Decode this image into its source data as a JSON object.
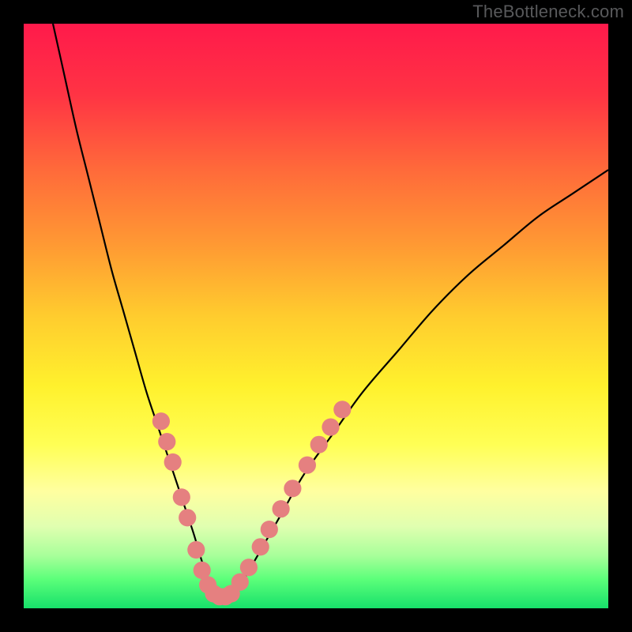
{
  "watermark": "TheBottleneck.com",
  "gradient": {
    "stops": [
      {
        "offset": 0,
        "color": "#ff1a4b"
      },
      {
        "offset": 12,
        "color": "#ff3344"
      },
      {
        "offset": 25,
        "color": "#ff6a3a"
      },
      {
        "offset": 38,
        "color": "#ff9a33"
      },
      {
        "offset": 50,
        "color": "#ffcc2e"
      },
      {
        "offset": 62,
        "color": "#fff12d"
      },
      {
        "offset": 72,
        "color": "#ffff55"
      },
      {
        "offset": 80,
        "color": "#ffffa0"
      },
      {
        "offset": 86,
        "color": "#e0ffb0"
      },
      {
        "offset": 91,
        "color": "#a8ff9a"
      },
      {
        "offset": 95,
        "color": "#5cff7a"
      },
      {
        "offset": 100,
        "color": "#17e06a"
      }
    ]
  },
  "chart_data": {
    "type": "line",
    "title": "",
    "xlabel": "",
    "ylabel": "",
    "xlim": [
      0,
      100
    ],
    "ylim": [
      0,
      100
    ],
    "grid": false,
    "legend": false,
    "series": [
      {
        "name": "curve",
        "x": [
          5,
          7,
          9,
          11,
          13,
          15,
          17,
          19,
          21,
          23,
          25,
          27,
          29,
          30.5,
          32,
          33.5,
          35,
          37,
          40,
          44,
          48,
          53,
          58,
          64,
          70,
          76,
          82,
          88,
          94,
          100
        ],
        "y": [
          100,
          91,
          82,
          74,
          66,
          58,
          51,
          44,
          37,
          31,
          25,
          19,
          13,
          8,
          4,
          2,
          2,
          4,
          9,
          16,
          23,
          30,
          37,
          44,
          51,
          57,
          62,
          67,
          71,
          75
        ]
      }
    ],
    "markers": {
      "name": "highlight-dots",
      "color": "#e58080",
      "radius": 1.5,
      "points": [
        {
          "x": 23.5,
          "y": 32
        },
        {
          "x": 24.5,
          "y": 28.5
        },
        {
          "x": 25.5,
          "y": 25
        },
        {
          "x": 27.0,
          "y": 19
        },
        {
          "x": 28.0,
          "y": 15.5
        },
        {
          "x": 29.5,
          "y": 10
        },
        {
          "x": 30.5,
          "y": 6.5
        },
        {
          "x": 31.5,
          "y": 4
        },
        {
          "x": 32.5,
          "y": 2.5
        },
        {
          "x": 33.5,
          "y": 2
        },
        {
          "x": 34.5,
          "y": 2
        },
        {
          "x": 35.5,
          "y": 2.5
        },
        {
          "x": 37.0,
          "y": 4.5
        },
        {
          "x": 38.5,
          "y": 7
        },
        {
          "x": 40.5,
          "y": 10.5
        },
        {
          "x": 42.0,
          "y": 13.5
        },
        {
          "x": 44.0,
          "y": 17
        },
        {
          "x": 46.0,
          "y": 20.5
        },
        {
          "x": 48.5,
          "y": 24.5
        },
        {
          "x": 50.5,
          "y": 28
        },
        {
          "x": 52.5,
          "y": 31
        },
        {
          "x": 54.5,
          "y": 34
        }
      ]
    }
  }
}
